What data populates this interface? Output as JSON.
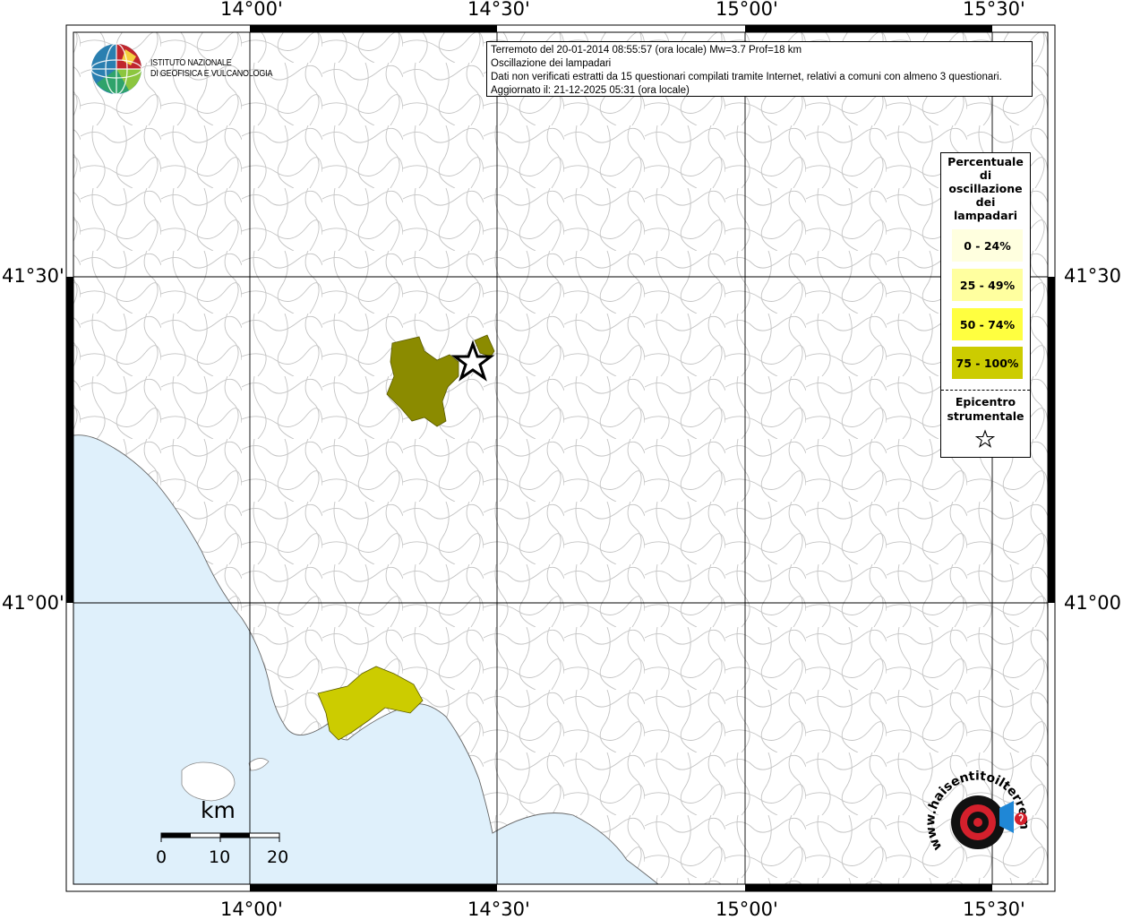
{
  "axes": {
    "top_labels": [
      "14°00'",
      "14°30'",
      "15°00'",
      "15°30'"
    ],
    "bottom_labels": [
      "14°00'",
      "14°30'",
      "15°00'",
      "15°30'"
    ],
    "left_labels": [
      "41°30'",
      "41°00'"
    ],
    "right_labels": [
      "41°30'",
      "41°00'"
    ]
  },
  "info": {
    "line1": "Terremoto del 20-01-2014 08:55:57 (ora locale) Mw=3.7 Prof=18 km",
    "line2": "Oscillazione dei lampadari",
    "line3": "Dati non verificati estratti da 15 questionari compilati tramite Internet, relativi a comuni con almeno 3 questionari.",
    "line4": "Aggiornato il: 21-12-2025 05:31 (ora locale)"
  },
  "logo": {
    "line1": "ISTITUTO NAZIONALE",
    "line2": "DI GEOFISICA E VULCANOLOGIA"
  },
  "legend": {
    "title_lines": [
      "Percentuale",
      "di",
      "oscillazione",
      "dei",
      "lampadari"
    ],
    "classes": [
      {
        "label": "0 - 24%",
        "color": "#ffffdf"
      },
      {
        "label": "25 - 49%",
        "color": "#ffff9f"
      },
      {
        "label": "50 - 74%",
        "color": "#ffff40"
      },
      {
        "label": "75 - 100%",
        "color": "#cccc00"
      }
    ],
    "epicentre_lines": [
      "Epicentro",
      "strumentale"
    ]
  },
  "regions": [
    {
      "name": "comune-north",
      "class": "75 - 100%",
      "color": "#8b8b00"
    },
    {
      "name": "comune-north-small",
      "class": "75 - 100%",
      "color": "#8b8b00"
    },
    {
      "name": "comune-napoli",
      "class": "75 - 100%",
      "color": "#cccc00"
    }
  ],
  "colors": {
    "sea": "#dff0fb",
    "boundary": "#bdbdbd",
    "grid": "#000000"
  },
  "scalebar": {
    "unit": "km",
    "ticks": [
      "0",
      "10",
      "20"
    ]
  },
  "watermark": {
    "text": "www.haisentitoilterremoto.it"
  }
}
